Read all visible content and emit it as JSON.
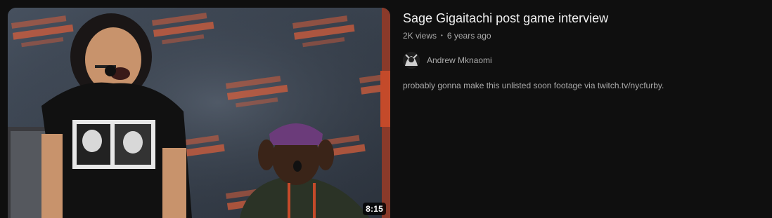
{
  "video": {
    "title": "Sage Gigaitachi post game interview",
    "views": "2K views",
    "age": "6 years ago",
    "duration": "8:15",
    "channel": "Andrew Mknaomi",
    "description": "probably gonna make this unlisted soon footage via twitch.tv/nycfurby.",
    "separator": "•"
  },
  "colors": {
    "page_bg": "#0f0f0f",
    "title": "#f1f1f1",
    "secondary_text": "#aaaaaa",
    "backdrop_logo": "#e2603a"
  },
  "icons": {
    "avatar": "channel-avatar-icon"
  }
}
